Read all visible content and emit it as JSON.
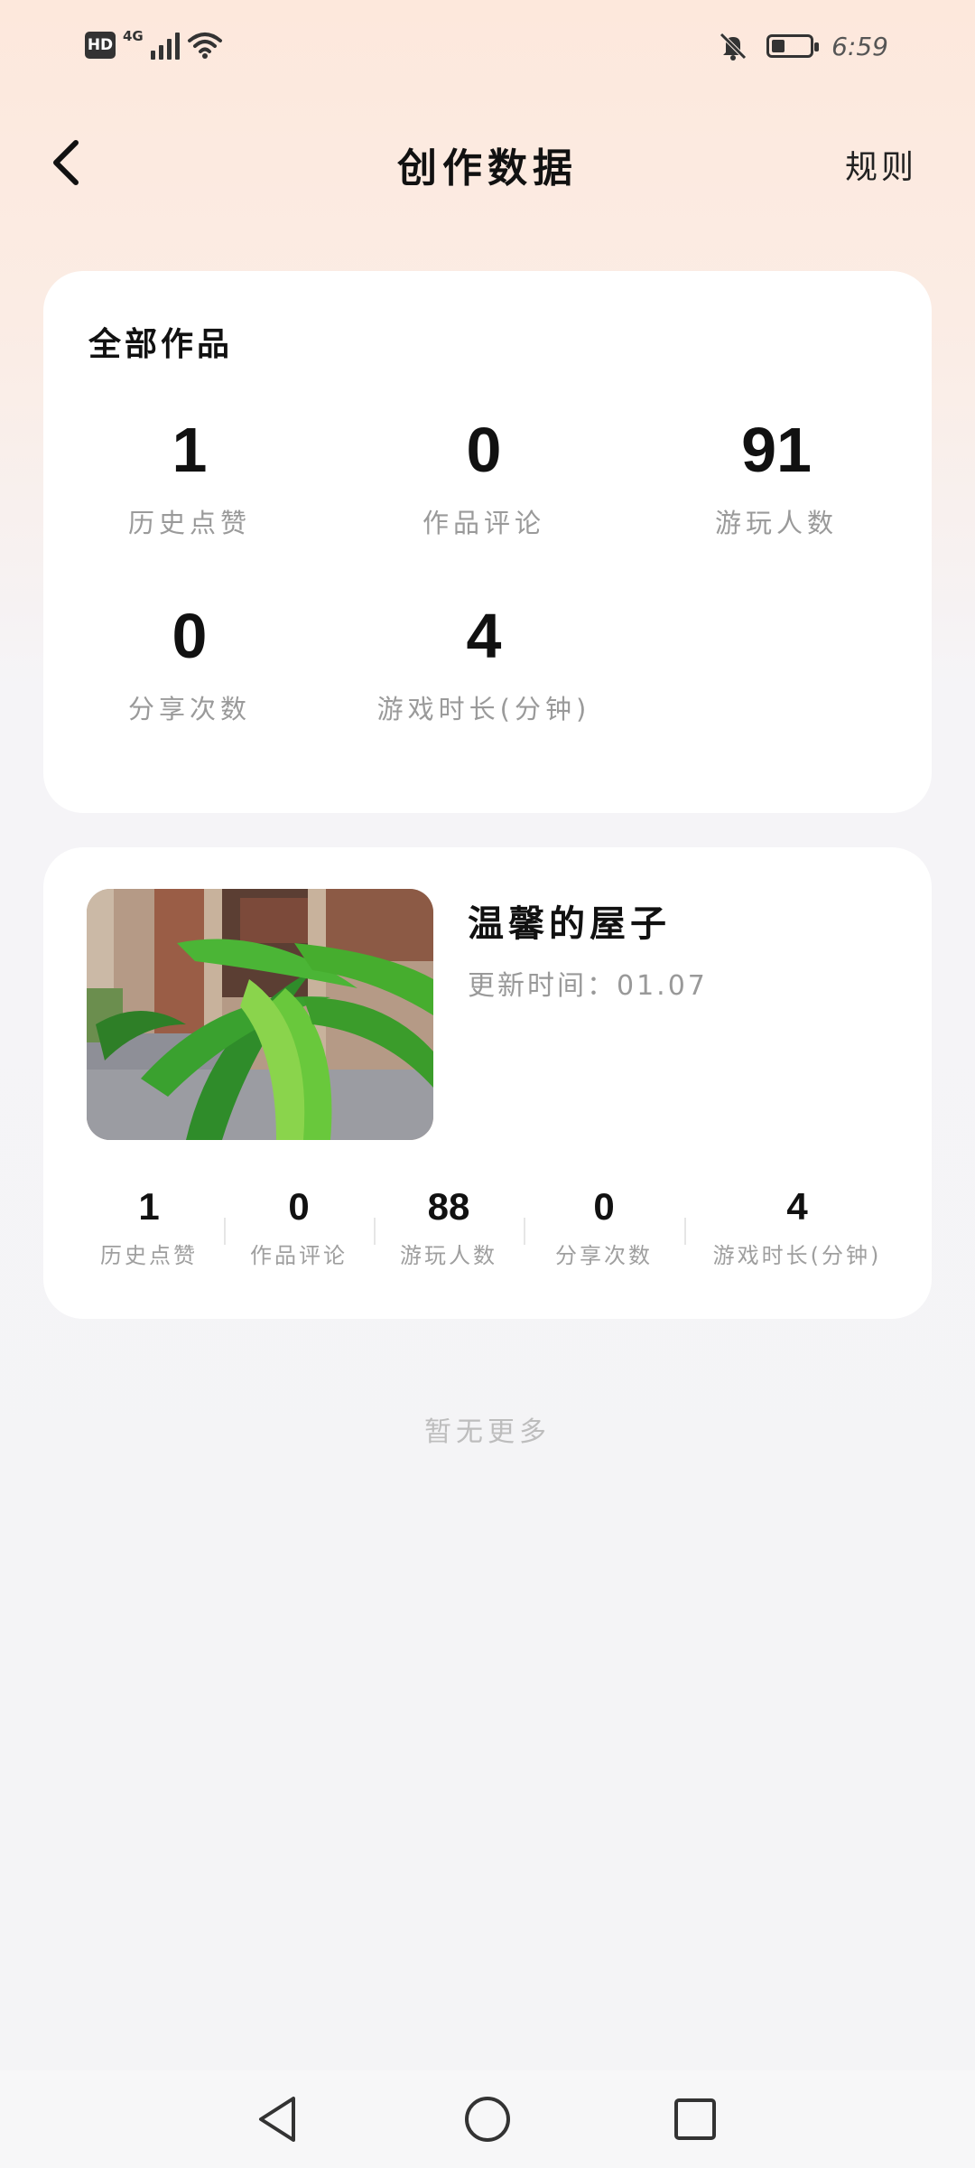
{
  "status_bar": {
    "hd": "HD",
    "network": "4G",
    "time": "6:59",
    "icons": [
      "signal-icon",
      "wifi-icon",
      "bell-off-icon",
      "battery-icon"
    ]
  },
  "header": {
    "title": "创作数据",
    "rules_label": "规则"
  },
  "summary": {
    "title": "全部作品",
    "stats": [
      {
        "value": "1",
        "label": "历史点赞"
      },
      {
        "value": "0",
        "label": "作品评论"
      },
      {
        "value": "91",
        "label": "游玩人数"
      },
      {
        "value": "0",
        "label": "分享次数"
      },
      {
        "value": "4",
        "label": "游戏时长(分钟)"
      }
    ]
  },
  "works": [
    {
      "title": "温馨的屋子",
      "updated": "更新时间：01.07",
      "stats": [
        {
          "value": "1",
          "label": "历史点赞"
        },
        {
          "value": "0",
          "label": "作品评论"
        },
        {
          "value": "88",
          "label": "游玩人数"
        },
        {
          "value": "0",
          "label": "分享次数"
        },
        {
          "value": "4",
          "label": "游戏时长(分钟)"
        }
      ]
    }
  ],
  "footer_note": "暂无更多",
  "nav": {
    "icons": [
      "back-triangle-icon",
      "home-circle-icon",
      "recents-square-icon"
    ]
  }
}
